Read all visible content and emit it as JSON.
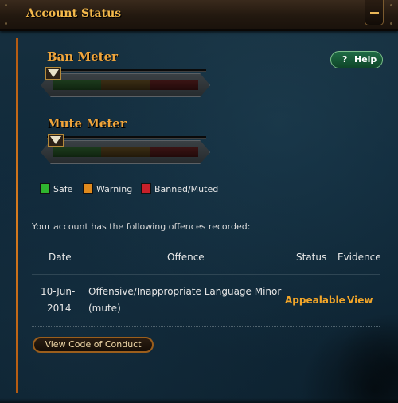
{
  "window": {
    "title": "Account Status"
  },
  "help": {
    "icon": "?",
    "label": "Help"
  },
  "meters": {
    "ban": {
      "title": "Ban Meter",
      "level": 0.0
    },
    "mute": {
      "title": "Mute Meter",
      "level": 0.0
    }
  },
  "legend": {
    "safe": {
      "label": "Safe",
      "color": "#2fb52f"
    },
    "warning": {
      "label": "Warning",
      "color": "#e08a1d"
    },
    "banned": {
      "label": "Banned/Muted",
      "color": "#c8202a"
    }
  },
  "offences": {
    "intro": "Your account has the following offences recorded:",
    "headers": {
      "date": "Date",
      "offence": "Offence",
      "status": "Status",
      "evidence": "Evidence"
    },
    "rows": [
      {
        "date_line1": "10-Jun-",
        "date_line2": "2014",
        "offence_line1": "Offensive/Inappropriate Language Minor",
        "offence_line2": "(mute)",
        "status": "Appealable",
        "evidence": "View"
      }
    ]
  },
  "footer": {
    "code_of_conduct_label": "View Code of Conduct"
  }
}
